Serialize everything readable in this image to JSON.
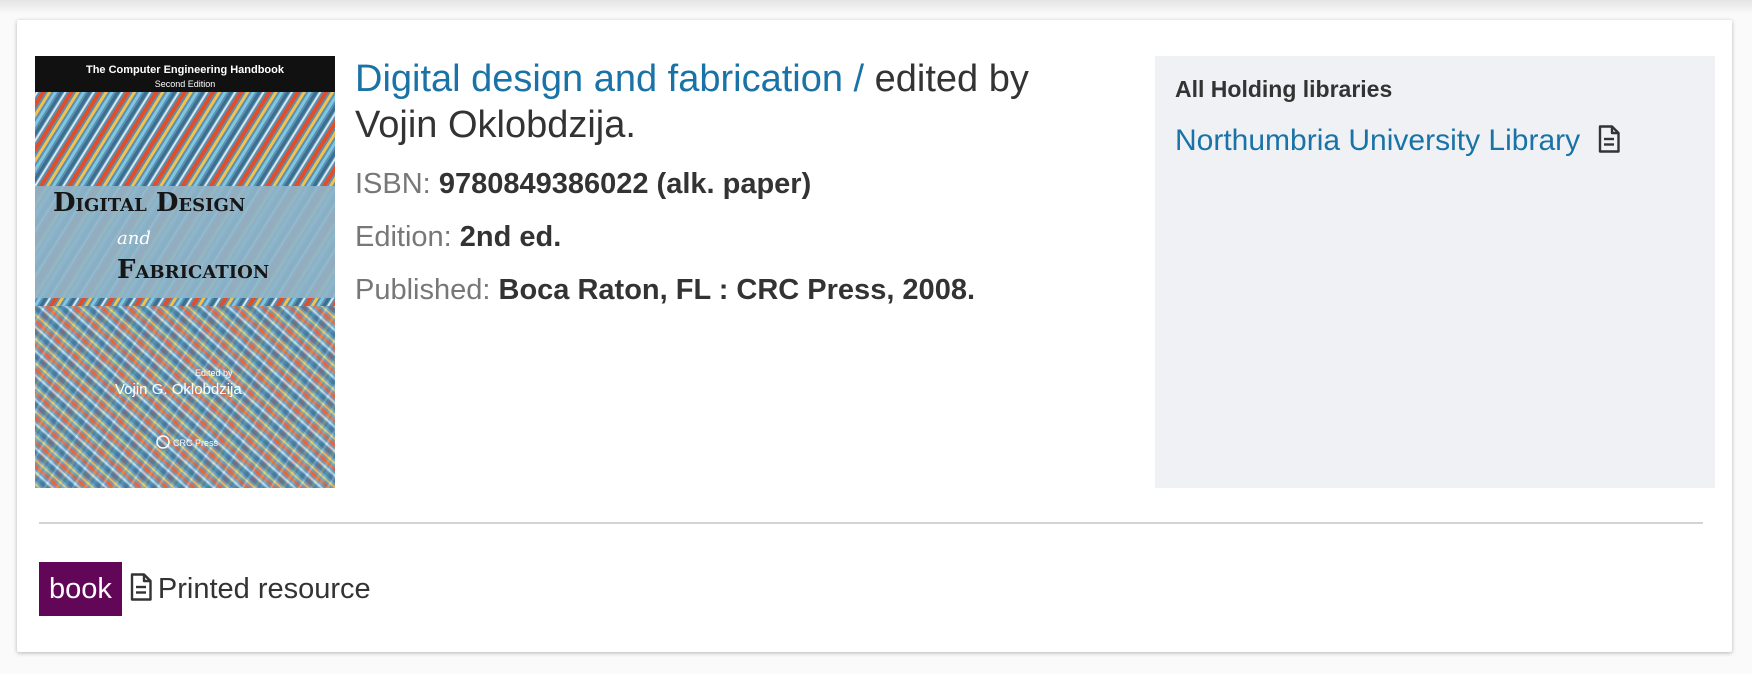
{
  "record": {
    "title": "Digital design and fabrication /",
    "responsibility": " edited by Vojin Oklobdzija.",
    "isbn_label": "ISBN:",
    "isbn_value": "9780849386022 (alk. paper)",
    "edition_label": "Edition:",
    "edition_value": "2nd ed.",
    "published_label": "Published:",
    "published_value": "Boca Raton, FL : CRC Press, 2008."
  },
  "cover": {
    "series": "The Computer Engineering Handbook",
    "series_edition": "Second Edition",
    "title_line1": "Digital Design",
    "title_and": "and",
    "title_line2": "Fabrication",
    "edited_by": "Edited by",
    "editor": "Vojin G. Oklobdzija",
    "publisher_logo": "CRC Press",
    "icon": "book-cover-image"
  },
  "holdings": {
    "heading": "All Holding libraries",
    "libraries": [
      {
        "name": "Northumbria University Library",
        "icon": "document-icon"
      }
    ]
  },
  "footer": {
    "badge": "book",
    "icon": "document-icon",
    "resource_type": "Printed resource"
  },
  "colors": {
    "link": "#1a73a7",
    "badge": "#620757",
    "holdings_bg": "#eff1f4",
    "label": "#777777",
    "text": "#333333"
  }
}
